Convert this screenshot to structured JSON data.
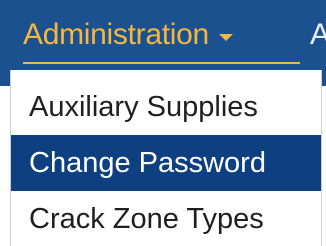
{
  "navbar": {
    "menu_label": "Administration",
    "next_menu_label": "A",
    "colors": {
      "background": "#1c5190",
      "active_text": "#f7b63e",
      "text": "#e9eef7"
    }
  },
  "dropdown": {
    "items": [
      {
        "label": "Auxiliary Supplies",
        "highlighted": false
      },
      {
        "label": "Change Password",
        "highlighted": true
      },
      {
        "label": "Crack Zone Types",
        "highlighted": false
      }
    ],
    "colors": {
      "highlight_background": "#0e3f80",
      "highlight_text": "#ffffff",
      "text": "#1f1f1f"
    }
  }
}
